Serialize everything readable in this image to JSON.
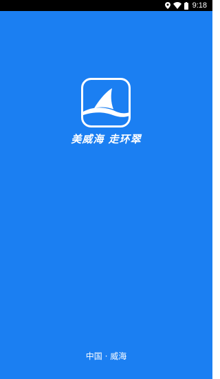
{
  "status_bar": {
    "time": "9:18",
    "icons": [
      "location-icon",
      "wifi-icon",
      "battery-icon"
    ]
  },
  "splash": {
    "logo_icon": "sailboat-logo-icon",
    "slogan": "美威海 走环翠",
    "footer": "中国 · 威海"
  },
  "colors": {
    "background": "#1b7ff2",
    "status_bar": "#000000",
    "text": "#ffffff"
  }
}
